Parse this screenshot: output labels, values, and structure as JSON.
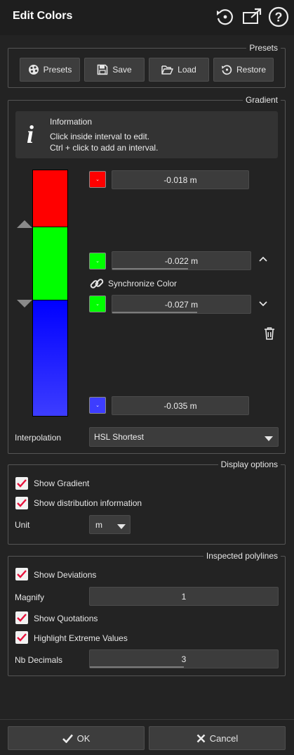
{
  "window": {
    "title": "Edit Colors",
    "icons": [
      "reset-icon",
      "popout-icon",
      "help-icon"
    ]
  },
  "presets": {
    "legend": "Presets",
    "buttons": [
      {
        "label": "Presets",
        "icon": "palette-icon"
      },
      {
        "label": "Save",
        "icon": "floppy-icon"
      },
      {
        "label": "Load",
        "icon": "folder-icon"
      },
      {
        "label": "Restore",
        "icon": "restore-icon"
      }
    ]
  },
  "gradient": {
    "legend": "Gradient",
    "info": {
      "title": "Information",
      "line1": "Click inside interval to edit.",
      "line2": "Ctrl + click to add an interval."
    },
    "stops": [
      {
        "value": "-0.018 m",
        "color": "#ff0000",
        "progress": null
      },
      {
        "value": "-0.022 m",
        "color": "#00ff00",
        "progress": 0.5
      },
      {
        "value": "-0.027 m",
        "color": "#00ff00",
        "progress": 0.5
      },
      {
        "value": "-0.035 m",
        "color": "#3d3dff",
        "progress": null
      }
    ],
    "bands": [
      {
        "color": "#ff0000"
      },
      {
        "color": "#00ff00"
      },
      {
        "color": "#0000ff",
        "color2": "#3d3dff"
      }
    ],
    "sync_label": "Synchronize Color",
    "interpolation_label": "Interpolation",
    "interpolation_value": "HSL Shortest"
  },
  "display": {
    "legend": "Display options",
    "show_gradient": {
      "label": "Show Gradient",
      "checked": true
    },
    "show_distribution": {
      "label": "Show distribution information",
      "checked": true
    },
    "unit_label": "Unit",
    "unit_value": "m"
  },
  "inspected": {
    "legend": "Inspected polylines",
    "show_deviations": {
      "label": "Show Deviations",
      "checked": true
    },
    "magnify_label": "Magnify",
    "magnify_value": "1",
    "show_quotations": {
      "label": "Show Quotations",
      "checked": true
    },
    "highlight_extreme": {
      "label": "Highlight Extreme Values",
      "checked": true
    },
    "nb_decimals_label": "Nb Decimals",
    "nb_decimals_value": "3",
    "nb_decimals_progress": 0.5
  },
  "footer": {
    "ok_label": "OK",
    "cancel_label": "Cancel"
  },
  "colors": {
    "background": "#232323",
    "check_mark": "#e8123c",
    "field": "#3c3c3c",
    "button": "#3d3d3d"
  }
}
